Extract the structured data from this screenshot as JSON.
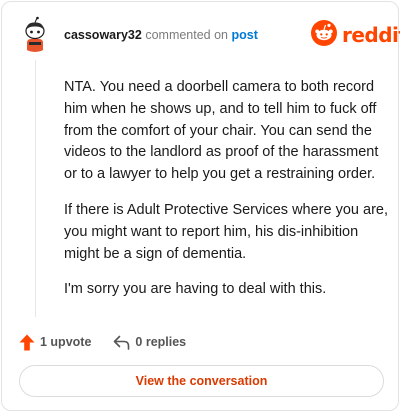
{
  "header": {
    "username": "cassowary32",
    "action_text": "commented on",
    "target_text": "post",
    "brand_name": "reddit",
    "brand_color": "#ff4500",
    "avatar_icon": "snoo-avatar-icon",
    "brand_icon": "reddit-logo-icon"
  },
  "comment": {
    "paragraphs": [
      "NTA. You need a doorbell camera to both record him when he shows up, and to tell him to fuck off from the comfort of your chair. You can send the videos to the landlord as proof of the harassment or to a lawyer to help you get a restraining order.",
      "If there is Adult Protective Services where you are, you might want to report him, his dis-inhibition might be a sign of dementia.",
      "I'm sorry you are having to deal with this."
    ]
  },
  "footer": {
    "upvote_label": "1 upvote",
    "upvote_icon": "upvote-arrow-icon",
    "upvote_color": "#ff4500",
    "replies_label": "0 replies",
    "replies_icon": "reply-arrow-icon"
  },
  "cta": {
    "label": "View the conversation",
    "color": "#d93a00"
  }
}
